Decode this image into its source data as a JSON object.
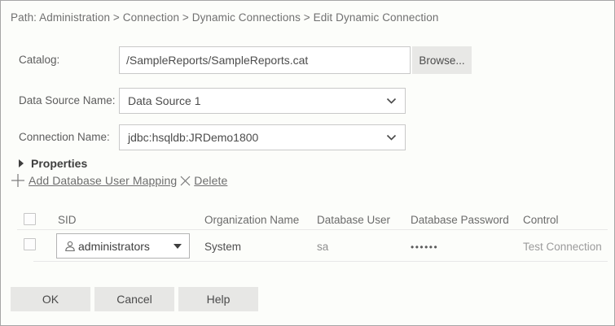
{
  "breadcrumb": {
    "text": "Path: Administration > Connection > Dynamic Connections > Edit Dynamic Connection"
  },
  "form": {
    "catalog": {
      "label": "Catalog:",
      "value": "/SampleReports/SampleReports.cat",
      "browse_label": "Browse..."
    },
    "data_source": {
      "label": "Data Source Name:",
      "value": "Data Source 1"
    },
    "connection": {
      "label": "Connection Name:",
      "value": "jdbc:hsqldb:JRDemo1800"
    }
  },
  "properties_section": {
    "label": "Properties"
  },
  "toolbar": {
    "add_label": "Add Database User Mapping",
    "delete_label": "Delete"
  },
  "table": {
    "headers": [
      "SID",
      "Organization Name",
      "Database User",
      "Database Password",
      "Control"
    ],
    "rows": [
      {
        "sid": "administrators",
        "organization": "System",
        "database_user": "sa",
        "database_password": "••••••",
        "control": "Test Connection"
      }
    ]
  },
  "buttons": {
    "ok": "OK",
    "cancel": "Cancel",
    "help": "Help"
  },
  "colors": {
    "page_background": "#fcfdfa",
    "button_background": "#e7e7e5",
    "link_color": "#6d6d6d",
    "text_primary": "#4c4c4c"
  }
}
